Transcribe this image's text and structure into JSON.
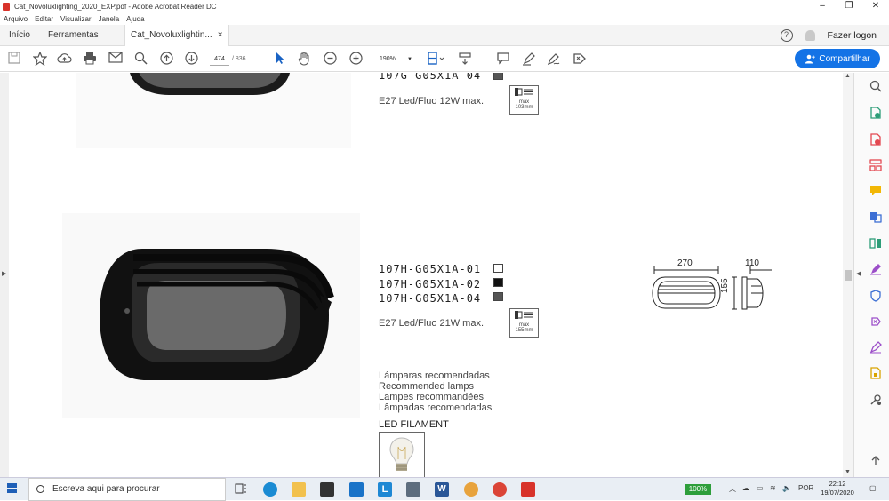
{
  "window": {
    "title": "Cat_Novoluxlighting_2020_EXP.pdf - Adobe Acrobat Reader DC",
    "menu": [
      "Arquivo",
      "Editar",
      "Visualizar",
      "Janela",
      "Ajuda"
    ]
  },
  "tabs": {
    "home": "Início",
    "tools": "Ferramentas",
    "document": "Cat_Novoluxlightin...",
    "close": "×",
    "help": "?",
    "logon": "Fazer logon"
  },
  "toolbar": {
    "page_current": "474",
    "page_total": "/ 836",
    "zoom": "190%",
    "share_label": "Compartilhar"
  },
  "document": {
    "top_product": {
      "code": "107G-G05X1A-04",
      "spec": "E27   Led/Fluo   12W max.",
      "max_label": "max",
      "max_value": "103mm"
    },
    "product": {
      "codes": [
        "107H-G05X1A-01",
        "107H-G05X1A-02",
        "107H-G05X1A-04"
      ],
      "swatch_colors": [
        "#ffffff",
        "#111111",
        "#555555"
      ],
      "spec": "E27   Led/Fluo   21W max.",
      "max_label": "max",
      "max_value": "155mm",
      "dim_width": "270",
      "dim_depth": "110",
      "dim_height": "155"
    },
    "recommended": {
      "lines": [
        "Lámparas recomendadas",
        "Recommended lamps",
        "Lampes recommandées",
        "Lâmpadas recomendadas"
      ],
      "led_label": "LED FILAMENT"
    }
  },
  "taskbar": {
    "search_placeholder": "Escreva aqui para procurar",
    "battery": "100%",
    "lang": "POR",
    "time": "22:12",
    "date": "19/07/2020"
  }
}
